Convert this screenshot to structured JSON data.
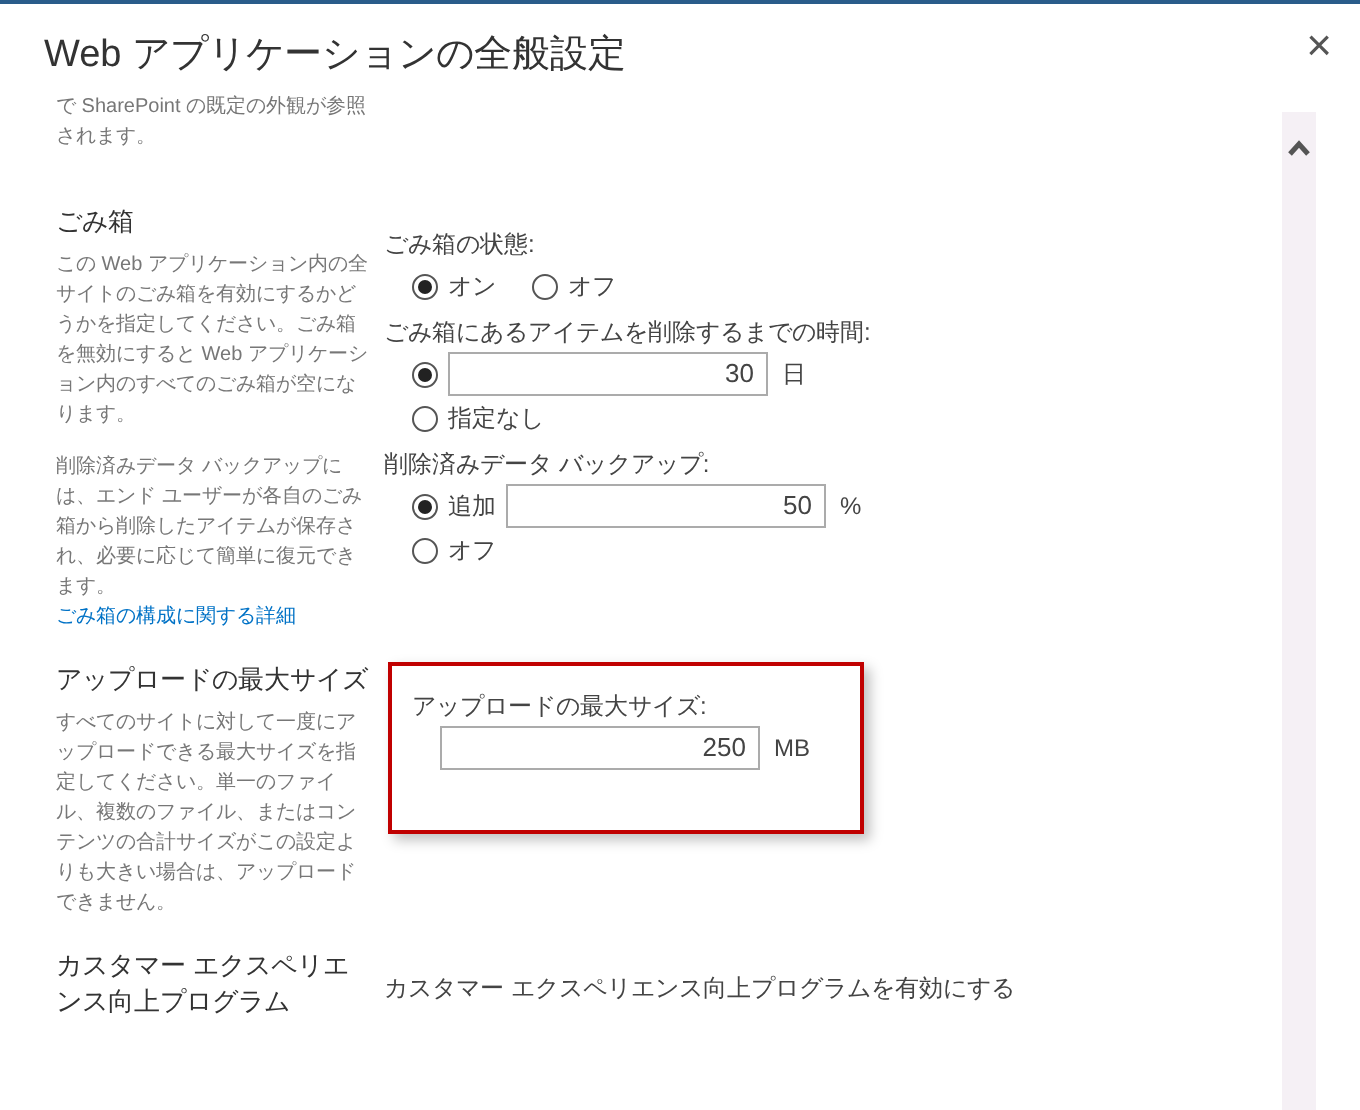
{
  "window": {
    "title": "Web アプリケーションの全般設定",
    "close": "×"
  },
  "sections": [
    {
      "description": [
        "で SharePoint の既定の外観が参照されます。"
      ]
    },
    {
      "heading": "ごみ箱",
      "description": [
        "この Web アプリケーション内の全サイトのごみ箱を有効にするかどうかを指定してください。ごみ箱を無効にすると Web アプリケーション内のすべてのごみ箱が空になります。",
        "削除済みデータ バックアップには、エンド ユーザーが各自のごみ箱から削除したアイテムが保存され、必要に応じて簡単に復元できます。"
      ],
      "link": "ごみ箱の構成に関する詳細",
      "groups": [
        {
          "label": "ごみ箱の状態:",
          "kind": "inline",
          "options": [
            {
              "label": "オン",
              "selected": true
            },
            {
              "label": "オフ",
              "selected": false
            }
          ]
        },
        {
          "label": "ごみ箱にあるアイテムを削除するまでの時間:",
          "kind": "stacked",
          "options": [
            {
              "value": "30",
              "unit": "日",
              "selected": true
            },
            {
              "label": "指定なし",
              "selected": false
            }
          ]
        },
        {
          "label": "削除済みデータ バックアップ:",
          "kind": "stacked",
          "options": [
            {
              "label": "追加",
              "value": "50",
              "unit": "%",
              "selected": true
            },
            {
              "label": "オフ",
              "selected": false
            }
          ]
        }
      ]
    },
    {
      "heading": "アップロードの最大サイズ",
      "description": [
        "すべてのサイトに対して一度にアップロードできる最大サイズを指定してください。単一のファイル、複数のファイル、またはコンテンツの合計サイズがこの設定よりも大きい場合は、アップロードできません。"
      ],
      "highlighted": true,
      "groups": [
        {
          "label": "アップロードの最大サイズ:",
          "kind": "stacked",
          "options": [
            {
              "value": "250",
              "unit": "MB"
            }
          ]
        }
      ]
    },
    {
      "heading": "カスタマー エクスペリエンス向上プログラム",
      "groups": [
        {
          "label": "カスタマー エクスペリエンス向上プログラムを有効にする",
          "kind": "stacked"
        }
      ]
    }
  ]
}
